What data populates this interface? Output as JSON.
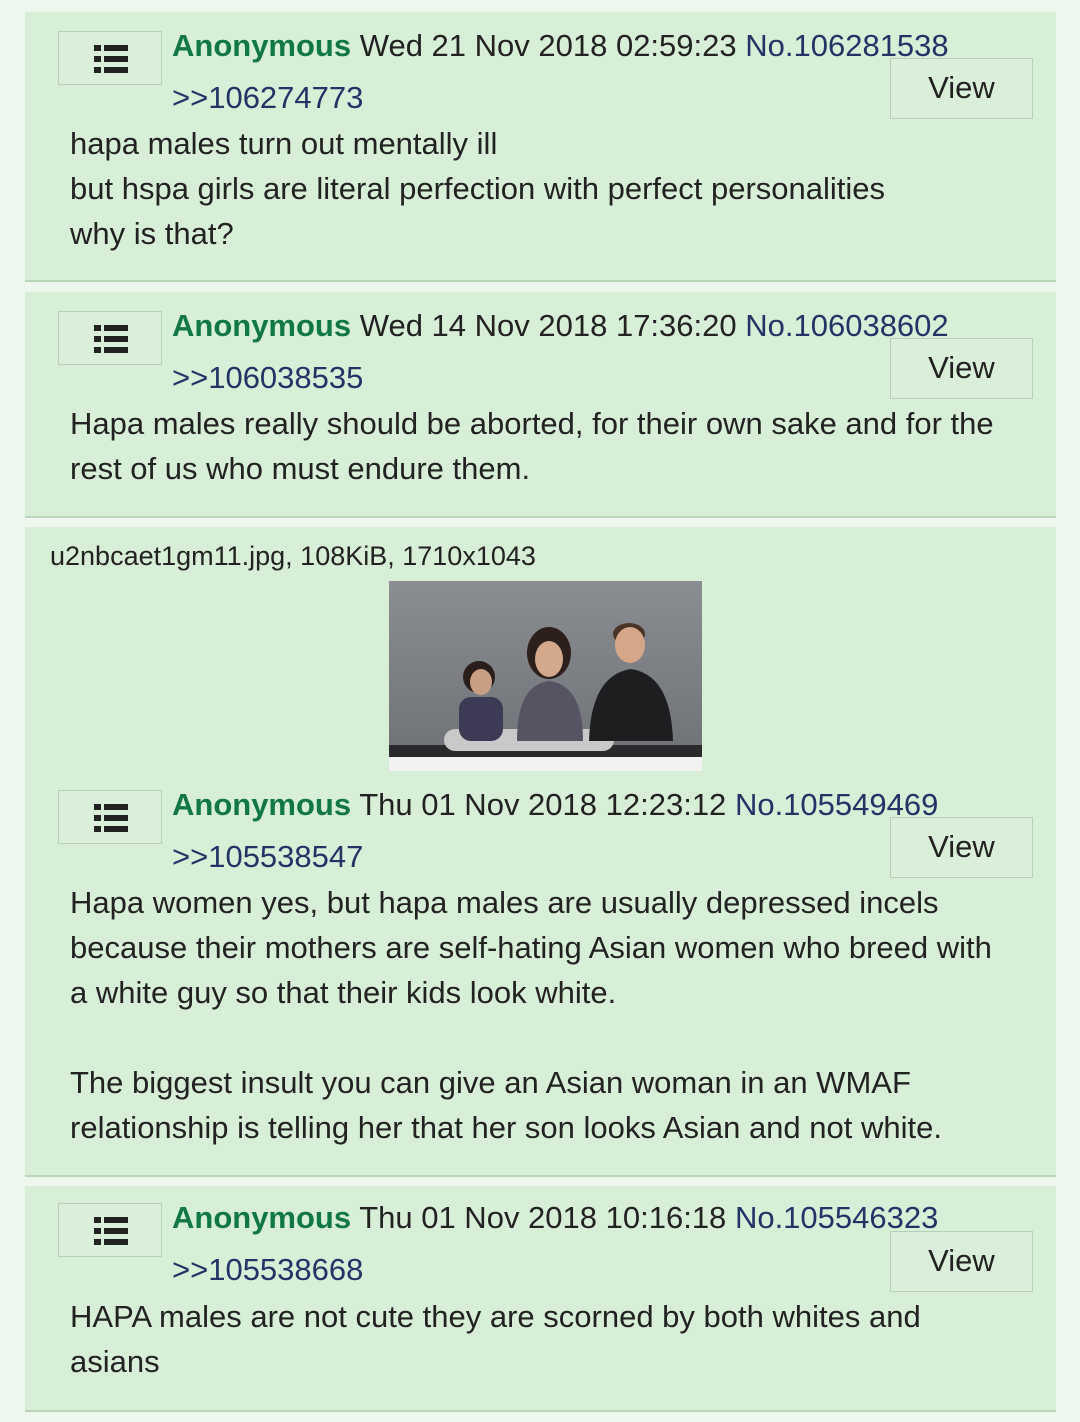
{
  "posts": [
    {
      "name": "Anonymous",
      "date": "Wed 21 Nov 2018 02:59:23",
      "no": "No.106281538",
      "quote": ">>106274773",
      "view": "View",
      "lines": [
        "hapa males turn out mentally ill",
        "but hspa girls are literal perfection with perfect personalities",
        "why is that?"
      ]
    },
    {
      "name": "Anonymous",
      "date": "Wed 14 Nov 2018 17:36:20",
      "no": "No.106038602",
      "quote": ">>106038535",
      "view": "View",
      "lines": [
        "Hapa males really should be aborted, for their own sake and for the",
        "rest of us who must endure them."
      ]
    },
    {
      "file": "u2nbcaet1gm11.jpg, 108KiB, 1710x1043",
      "name": "Anonymous",
      "date": "Thu 01 Nov 2018 12:23:12",
      "no": "No.105549469",
      "quote": ">>105538547",
      "view": "View",
      "lines": [
        "Hapa women yes, but hapa males are usually depressed incels",
        "because their mothers are self-hating Asian women who breed with",
        "a white guy so that their kids look white."
      ],
      "lines2": [
        "The biggest insult you can give an Asian woman in an WMAF",
        "relationship is telling her that her son looks Asian and not white."
      ]
    },
    {
      "name": "Anonymous",
      "date": "Thu 01 Nov 2018 10:16:18",
      "no": "No.105546323",
      "quote": ">>105538668",
      "view": "View",
      "lines": [
        "HAPA males are not cute they are scorned by both whites and",
        "asians"
      ]
    }
  ],
  "colors": {
    "post_bg": "#d7efd7",
    "name": "#117743",
    "post_no": "#223366",
    "page_bg": "#eef7ee"
  },
  "icons": {
    "menu": "list-icon"
  }
}
